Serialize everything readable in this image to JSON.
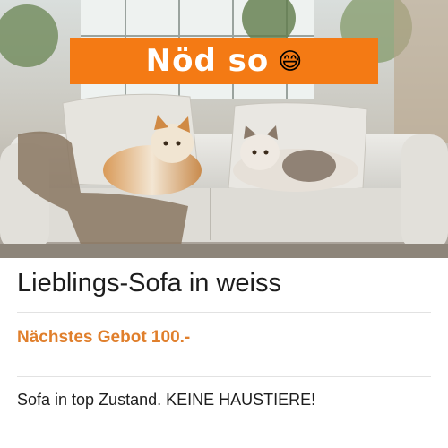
{
  "banner": {
    "text": "Nöd so",
    "emoji": "😅"
  },
  "listing": {
    "title": "Lieblings-Sofa in weiss",
    "next_bid": "Nächstes Gebot 100.-",
    "description": "Sofa in top Zustand. KEINE HAUSTIERE!"
  },
  "colors": {
    "banner_bg": "#f47a14",
    "bid_text": "#e07f2c"
  }
}
